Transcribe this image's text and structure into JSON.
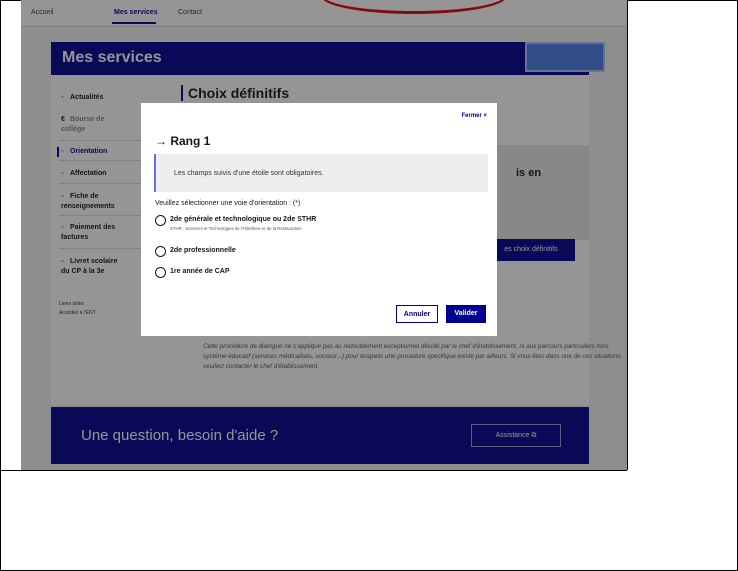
{
  "nav": {
    "items": [
      "Accueil",
      "Mes services",
      "Contact"
    ]
  },
  "banner": {
    "title": "Mes services"
  },
  "sidebar": {
    "items": [
      {
        "label": "Actualités",
        "icon": "bell-icon"
      },
      {
        "label": "Bourse de collège",
        "icon": "euro-icon"
      },
      {
        "label": "Orientation",
        "icon": "compass-icon"
      },
      {
        "label": "Affectation",
        "icon": "pin-icon"
      },
      {
        "label": "Fiche de renseignements",
        "icon": "file-icon"
      },
      {
        "label": "Paiement des factures",
        "icon": "card-icon"
      },
      {
        "label": "Livret scolaire du CP à la 3e",
        "icon": "book-icon"
      }
    ],
    "links": [
      "Liens utiles",
      "Accédez à l'ENT"
    ]
  },
  "main": {
    "title": "Choix définitifs",
    "box_fragment": "is en",
    "choix_button": "es choix définitifs",
    "paragraph": "Cette procédure de dialogue ne s'applique pas au redoublement exceptionnel décidé par le chef d'établissement, ni aux parcours particuliers hors système éducatif (services médicalisés, sociaux...) pour lesquels une procédure spécifique existe par ailleurs. Si vous êtes dans une de ces situations, veuillez contacter le chef d'établissement."
  },
  "help": {
    "title": "Une question, besoin d'aide ?",
    "button": "Assistance"
  },
  "modal": {
    "close": "Fermer ×",
    "title": "→ Rang 1",
    "notice": "Les champs suivis d'une étoile sont obligatoires.",
    "legend": "Veuillez sélectionner une voie d'orientation : (*)",
    "options": [
      {
        "label": "2de générale et technologique ou 2de STHR",
        "hint": "STHR : Sciences et Technologies de l'Hôtellerie et de la Restauration"
      },
      {
        "label": "2de professionnelle",
        "hint": ""
      },
      {
        "label": "1re année de CAP",
        "hint": ""
      }
    ],
    "cancel": "Annuler",
    "validate": "Valider"
  },
  "colors": {
    "primary": "#000091",
    "overlay": "rgba(20,20,20,0.45)",
    "highlight": "#4b7be5",
    "annotation": "#e1000f"
  }
}
